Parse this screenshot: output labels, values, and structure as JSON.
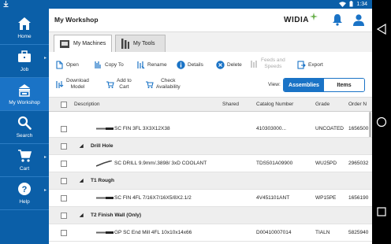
{
  "status": {
    "time": "1:34"
  },
  "sidebar": {
    "items": [
      {
        "label": "Home",
        "icon": "home-icon"
      },
      {
        "label": "Job",
        "icon": "briefcase-icon"
      },
      {
        "label": "My Workshop",
        "icon": "workshop-icon"
      },
      {
        "label": "Search",
        "icon": "search-icon"
      },
      {
        "label": "Cart",
        "icon": "cart-icon"
      },
      {
        "label": "Help",
        "icon": "help-icon"
      }
    ],
    "active": "My Workshop"
  },
  "header": {
    "title": "My Workshop",
    "logo": "WIDIA"
  },
  "tabs": [
    {
      "label": "My Machines",
      "active": true
    },
    {
      "label": "My Tools",
      "active": false
    }
  ],
  "toolbar": {
    "open": "Open",
    "copy_to": "Copy To",
    "rename": "Rename",
    "details": "Details",
    "delete": "Delete",
    "feeds_1": "Feeds and",
    "feeds_2": "Speeds",
    "export": "Export",
    "download_1": "Download",
    "download_2": "Model",
    "add_1": "Add to",
    "add_2": "Cart",
    "check_1": "Check",
    "check_2": "Availability",
    "view_label": "View:",
    "view_options": [
      "Assemblies",
      "Items"
    ],
    "view_selected": "Assemblies"
  },
  "table": {
    "columns": [
      "Description",
      "Shared",
      "Catalog Number",
      "Grade",
      "Order N"
    ],
    "rows": [
      {
        "type": "item",
        "description": "SC FIN 3FL 3X3X12X38",
        "catalog": "410303000...",
        "grade": "UNCOATED",
        "order": "1656500"
      },
      {
        "type": "group",
        "description": "Drill Hole"
      },
      {
        "type": "item",
        "description": "SC DRILL 9.9mm/.3898/ 3xD COOLANT",
        "catalog": "TDS501A09900",
        "grade": "WU25PD",
        "order": "2965032"
      },
      {
        "type": "group",
        "description": "T1 Rough"
      },
      {
        "type": "item",
        "description": "SC FIN 4FL 7/16X7/16X5/8X2.1/2",
        "catalog": "4V451101ANT",
        "grade": "WP15PE",
        "order": "1656190"
      },
      {
        "type": "group",
        "description": "T2 Finish Wall (Only)"
      },
      {
        "type": "item",
        "description": "GP SC End Mill 4FL 10x10x14x66",
        "catalog": "D00410007014",
        "grade": "TIALN",
        "order": "5825940"
      }
    ]
  },
  "colors": {
    "brand_blue": "#0b5fa8",
    "accent_blue": "#1a73c6"
  }
}
